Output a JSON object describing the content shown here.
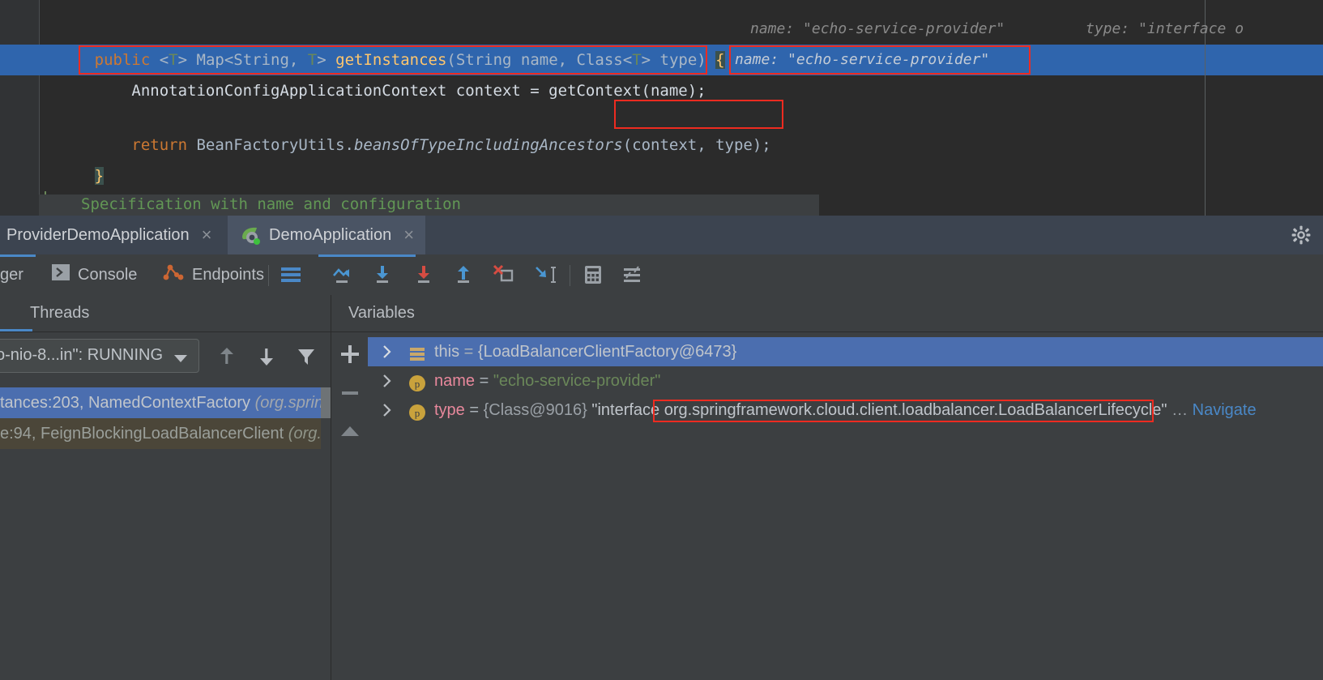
{
  "editor": {
    "code_lines": [
      {
        "id": "signature",
        "tokens": [
          {
            "t": "public ",
            "cls": "kw"
          },
          {
            "t": "<",
            "cls": "plain"
          },
          {
            "t": "T",
            "cls": "gen"
          },
          {
            "t": "> Map<String, ",
            "cls": "plain"
          },
          {
            "t": "T",
            "cls": "gen"
          },
          {
            "t": "> ",
            "cls": "plain"
          },
          {
            "t": "getInstances",
            "cls": "mth"
          },
          {
            "t": "(String name, Class<",
            "cls": "plain"
          },
          {
            "t": "T",
            "cls": "gen"
          },
          {
            "t": "> type) ",
            "cls": "plain"
          },
          {
            "t": "{",
            "cls": "brace"
          }
        ]
      },
      {
        "id": "context-assign",
        "tokens": [
          {
            "t": "    AnnotationConfigApplicationContext context = getContext(name);",
            "cls": "plain"
          }
        ]
      },
      {
        "id": "return-stmt",
        "tokens": [
          {
            "t": "    ",
            "cls": "plain"
          },
          {
            "t": "return ",
            "cls": "kw"
          },
          {
            "t": "BeanFactoryUtils.",
            "cls": "plain"
          },
          {
            "t": "beansOfTypeIncludingAncestors",
            "cls": "ital"
          },
          {
            "t": "(context, type);",
            "cls": "plain"
          }
        ]
      }
    ],
    "closing_brace": "}",
    "inline_hints": [
      {
        "id": "hint-name-line1",
        "text": "name: \"echo-service-provider\""
      },
      {
        "id": "hint-type-line1",
        "text": "type: \"interface o"
      },
      {
        "id": "hint-name-line2",
        "text": "name: \"echo-service-provider\""
      }
    ],
    "folded_comment": "Specification with name and configuration"
  },
  "debug": {
    "tabs": [
      {
        "id": "provider-demo-application",
        "label": "ProviderDemoApplication",
        "close": "×",
        "active": false,
        "has_icon": false
      },
      {
        "id": "demo-application",
        "label": "DemoApplication",
        "close": "×",
        "active": true,
        "has_icon": true
      }
    ],
    "settings_icon": "gear-icon",
    "toolbar_tabs": [
      {
        "id": "debugger",
        "label": "ger",
        "icon": null,
        "active": true
      },
      {
        "id": "console",
        "label": "Console",
        "icon": "console-icon",
        "active": false
      },
      {
        "id": "endpoints",
        "label": "Endpoints",
        "icon": "endpoints-icon",
        "active": false
      }
    ],
    "toolbar_icons": [
      {
        "id": "layout-settings",
        "name": "layout-settings-icon"
      },
      {
        "id": "step-over",
        "name": "step-over-icon"
      },
      {
        "id": "step-into",
        "name": "step-into-icon"
      },
      {
        "id": "force-step-into",
        "name": "force-step-into-icon"
      },
      {
        "id": "step-out",
        "name": "step-out-icon"
      },
      {
        "id": "drop-frame",
        "name": "drop-frame-icon"
      },
      {
        "id": "run-to-cursor",
        "name": "run-to-cursor-icon"
      },
      {
        "id": "evaluate-expression",
        "name": "calculator-icon"
      },
      {
        "id": "mute-breakpoints",
        "name": "settings-sliders-icon"
      }
    ],
    "panels": {
      "threads_title": "Threads",
      "variables_title": "Variables"
    },
    "threads": {
      "selected_thread": "o-nio-8...in\": RUNNING",
      "dropdown_arrow": "▾",
      "buttons": [
        {
          "id": "move-up",
          "name": "arrow-up-icon"
        },
        {
          "id": "move-down",
          "name": "arrow-down-icon"
        },
        {
          "id": "filter",
          "name": "filter-icon"
        }
      ],
      "frames": [
        {
          "id": "frame-0",
          "method": "tances:203, NamedContextFactory ",
          "pkg": "(org.springfr",
          "state": "selected"
        },
        {
          "id": "frame-1",
          "method": "e:94, FeignBlockingLoadBalancerClient ",
          "pkg": "(org.spr",
          "state": "current"
        }
      ]
    },
    "variables": {
      "side_buttons": [
        {
          "id": "add-watch",
          "name": "plus-icon",
          "glyph": "+"
        },
        {
          "id": "remove-watch",
          "name": "minus-icon",
          "glyph": "−"
        },
        {
          "id": "collapse",
          "name": "triangle-up-icon",
          "glyph": "▲"
        }
      ],
      "rows": [
        {
          "id": "var-this",
          "selected": true,
          "icon": "field-group-icon",
          "name": "this",
          "eq": " = ",
          "value": "{LoadBalancerClientFactory@6473}",
          "value_kind": "object"
        },
        {
          "id": "var-name",
          "selected": false,
          "icon": "parameter-icon",
          "name": "name",
          "eq": " = ",
          "value": "\"echo-service-provider\"",
          "value_kind": "string"
        },
        {
          "id": "var-type",
          "selected": false,
          "icon": "parameter-icon",
          "name": "type",
          "eq": " = ",
          "value_class": "{Class@9016} ",
          "value_prefix": "\"interface ",
          "value_highlight": "org.springframework.cloud.client.loadbalancer.LoadBalancerLifecycle",
          "value_suffix": "\"",
          "ellipsis": " … ",
          "navigate": "Navigate",
          "value_kind": "class"
        }
      ]
    }
  },
  "colors": {
    "editor_bg": "#2b2b2b",
    "gutter_bg": "#313335",
    "selection_blue": "#2f65ad",
    "panel_bg": "#3c3f41",
    "tabbar_bg": "#3c4450",
    "tab_active_bg": "#4a5464",
    "accent_blue": "#4a88c7",
    "row_selected": "#4b6eaf",
    "row_current": "#4b4639",
    "highlight_red": "#ee2b20",
    "keyword_orange": "#cc7832",
    "method_yellow": "#ffc66d",
    "string_green": "#6a8759",
    "comment_green": "#629755",
    "text_gray": "#a9b7c6"
  }
}
